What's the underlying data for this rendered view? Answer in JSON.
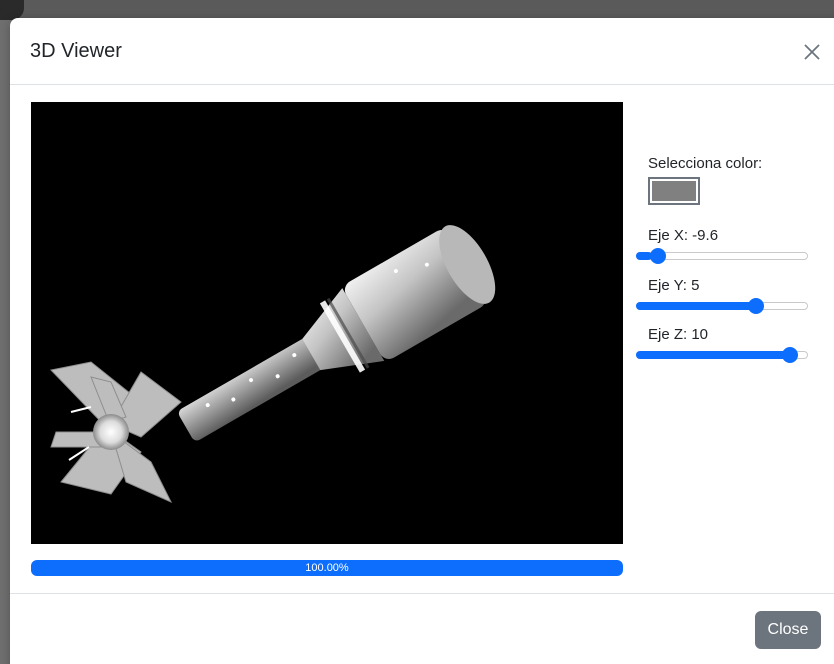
{
  "modal": {
    "title": "3D Viewer",
    "close_icon": "close-x-icon",
    "close_button_label": "Close"
  },
  "viewer": {
    "model_description_icon": "mortar-shell-3d-model",
    "background_color": "#000000",
    "model_color": "#808080"
  },
  "progress": {
    "label": "100.00%",
    "value_percent": 100,
    "bar_color": "#0d6efd"
  },
  "controls": {
    "color_label": "Selecciona color:",
    "selected_color": "#808080",
    "axes": [
      {
        "label": "Eje X: -9.6",
        "value": -9.6,
        "min": -10,
        "max": 10
      },
      {
        "label": "Eje Y: 5",
        "value": 5,
        "min": -10,
        "max": 10
      },
      {
        "label": "Eje Z: 10",
        "value": 10,
        "min": -10,
        "max": 10
      }
    ]
  },
  "colors": {
    "accent": "#0d6efd",
    "secondary_button": "#6c757d"
  }
}
